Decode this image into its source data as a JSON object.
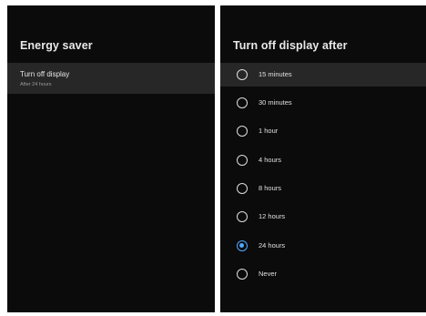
{
  "left": {
    "title": "Energy saver",
    "setting": {
      "title": "Turn off display",
      "subtitle": "After 24 hours"
    }
  },
  "right": {
    "title": "Turn off display after",
    "options": [
      {
        "label": "15 minutes",
        "selected": false,
        "focused": true
      },
      {
        "label": "30 minutes",
        "selected": false,
        "focused": false
      },
      {
        "label": "1 hour",
        "selected": false,
        "focused": false
      },
      {
        "label": "4 hours",
        "selected": false,
        "focused": false
      },
      {
        "label": "8 hours",
        "selected": false,
        "focused": false
      },
      {
        "label": "12 hours",
        "selected": false,
        "focused": false
      },
      {
        "label": "24 hours",
        "selected": true,
        "focused": false
      },
      {
        "label": "Never",
        "selected": false,
        "focused": false
      }
    ]
  },
  "colors": {
    "panel_bg": "#0b0b0b",
    "focus_bg": "#272727",
    "accent": "#4ea8ff"
  }
}
